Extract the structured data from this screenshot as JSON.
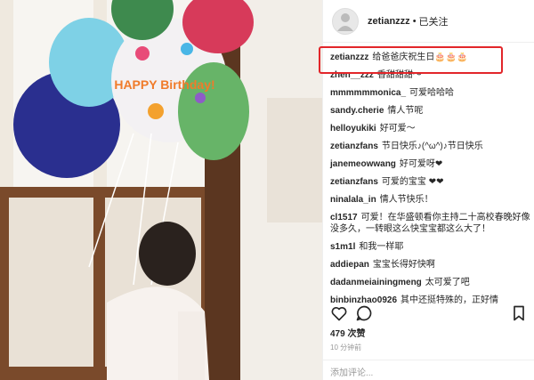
{
  "post": {
    "username": "zetianzzz",
    "separator": "•",
    "follow_status": "已关注",
    "caption": {
      "user": "zetianzzz",
      "text": "给爸爸庆祝生日🎂🎂🎂"
    },
    "balloon_text": "HAPPY Birthday!"
  },
  "comments": [
    {
      "user": "zhen__zzz",
      "text": "香甜甜甜～"
    },
    {
      "user": "mmmmmmonica_",
      "text": "可爱哈哈哈"
    },
    {
      "user": "sandy.cherie",
      "text": "情人节呢"
    },
    {
      "user": "helloyukiki",
      "text": "好可爱～"
    },
    {
      "user": "zetianzfans",
      "text": "节日快乐♪(^ω^)♪节日快乐"
    },
    {
      "user": "janemeowwang",
      "text": "好可爱呀❤"
    },
    {
      "user": "zetianzfans",
      "text": "可爱的宝宝 ❤❤"
    },
    {
      "user": "ninalala_in",
      "text": "情人节快乐！"
    },
    {
      "user": "cl1517",
      "text": "可爱！在华盛顿看你主持二十高校春晚好像没多久，一转眼这么快宝宝都这么大了！"
    },
    {
      "user": "s1m1l",
      "text": "和我一样耶"
    },
    {
      "user": "addiepan",
      "text": "宝宝长得好快啊"
    },
    {
      "user": "dadanmeiainingmeng",
      "text": "太可爱了吧"
    },
    {
      "user": "binbinzhao0926",
      "text": "其中还挺特殊的，正好情"
    }
  ],
  "likes": "479 次赞",
  "time": "10 分钟前",
  "add_comment_placeholder": "添加评论...",
  "colors": {
    "highlight": "#e2262a",
    "muted": "#999999"
  },
  "icons": [
    "heart-icon",
    "comment-icon",
    "bookmark-icon"
  ]
}
